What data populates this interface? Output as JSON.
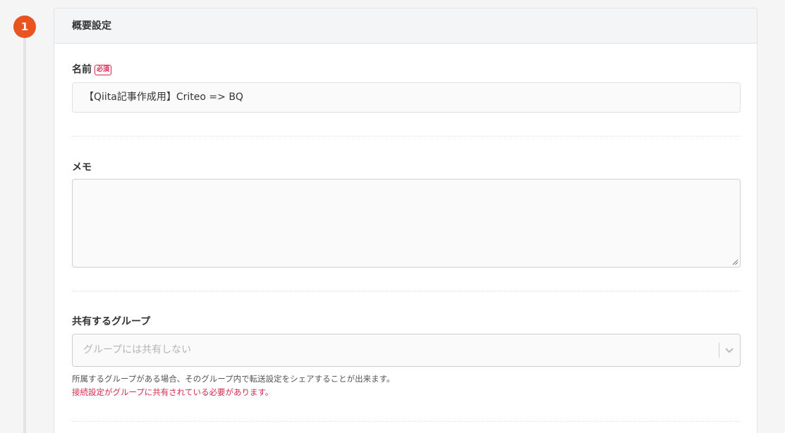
{
  "step": {
    "number": "1"
  },
  "card": {
    "title": "概要設定"
  },
  "name_field": {
    "label": "名前",
    "required_label": "必須",
    "value": "【Qiita記事作成用】Criteo => BQ"
  },
  "memo_field": {
    "label": "メモ",
    "value": ""
  },
  "group_field": {
    "label": "共有するグループ",
    "placeholder": "グループには共有しない",
    "help_text": "所属するグループがある場合、そのグループ内で転送設定をシェアすることが出来ます。",
    "warning_text": "接続設定がグループに共有されている必要があります。"
  },
  "icons": {
    "dropdown": "chevron-down-icon",
    "resize": "resize-grip-icon"
  },
  "colors": {
    "step_badge": "#e8531f",
    "required": "#d6284d",
    "warning": "#d6284d"
  }
}
